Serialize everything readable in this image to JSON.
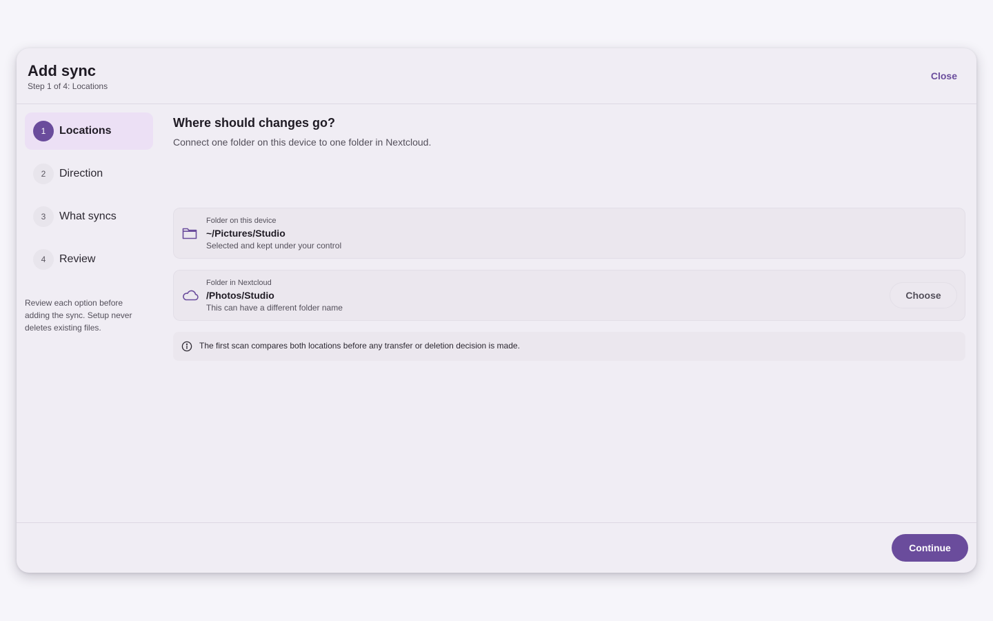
{
  "dialog": {
    "title": "Add sync",
    "subtitle": "Step 1 of 4: Locations",
    "close_label": "Close"
  },
  "steps": [
    {
      "number": "1",
      "label": "Locations",
      "active": true
    },
    {
      "number": "2",
      "label": "Direction",
      "active": false
    },
    {
      "number": "3",
      "label": "What syncs",
      "active": false
    },
    {
      "number": "4",
      "label": "Review",
      "active": false
    }
  ],
  "sidebar_note": "Review each option before adding the sync. Setup never deletes existing files.",
  "main": {
    "title": "Where should changes go?",
    "description": "Connect one folder on this device to one folder in Nextcloud."
  },
  "local_folder": {
    "icon": "folder-icon",
    "label": "Folder on this device",
    "path": "~/Pictures/Studio",
    "hint": "Selected and kept under your control"
  },
  "remote_folder": {
    "icon": "cloud-icon",
    "label": "Folder in Nextcloud",
    "path": "/Photos/Studio",
    "hint": "This can have a different folder name",
    "choose_label": "Choose"
  },
  "notice": {
    "icon": "info-icon",
    "text": "The first scan compares both locations before any transfer or deletion decision is made."
  },
  "footer": {
    "continue_label": "Continue"
  },
  "colors": {
    "accent": "#6a4c9c",
    "active_step_bg": "#ece0f5",
    "dialog_bg": "#f0edf4",
    "page_bg": "#f6f5fa"
  }
}
